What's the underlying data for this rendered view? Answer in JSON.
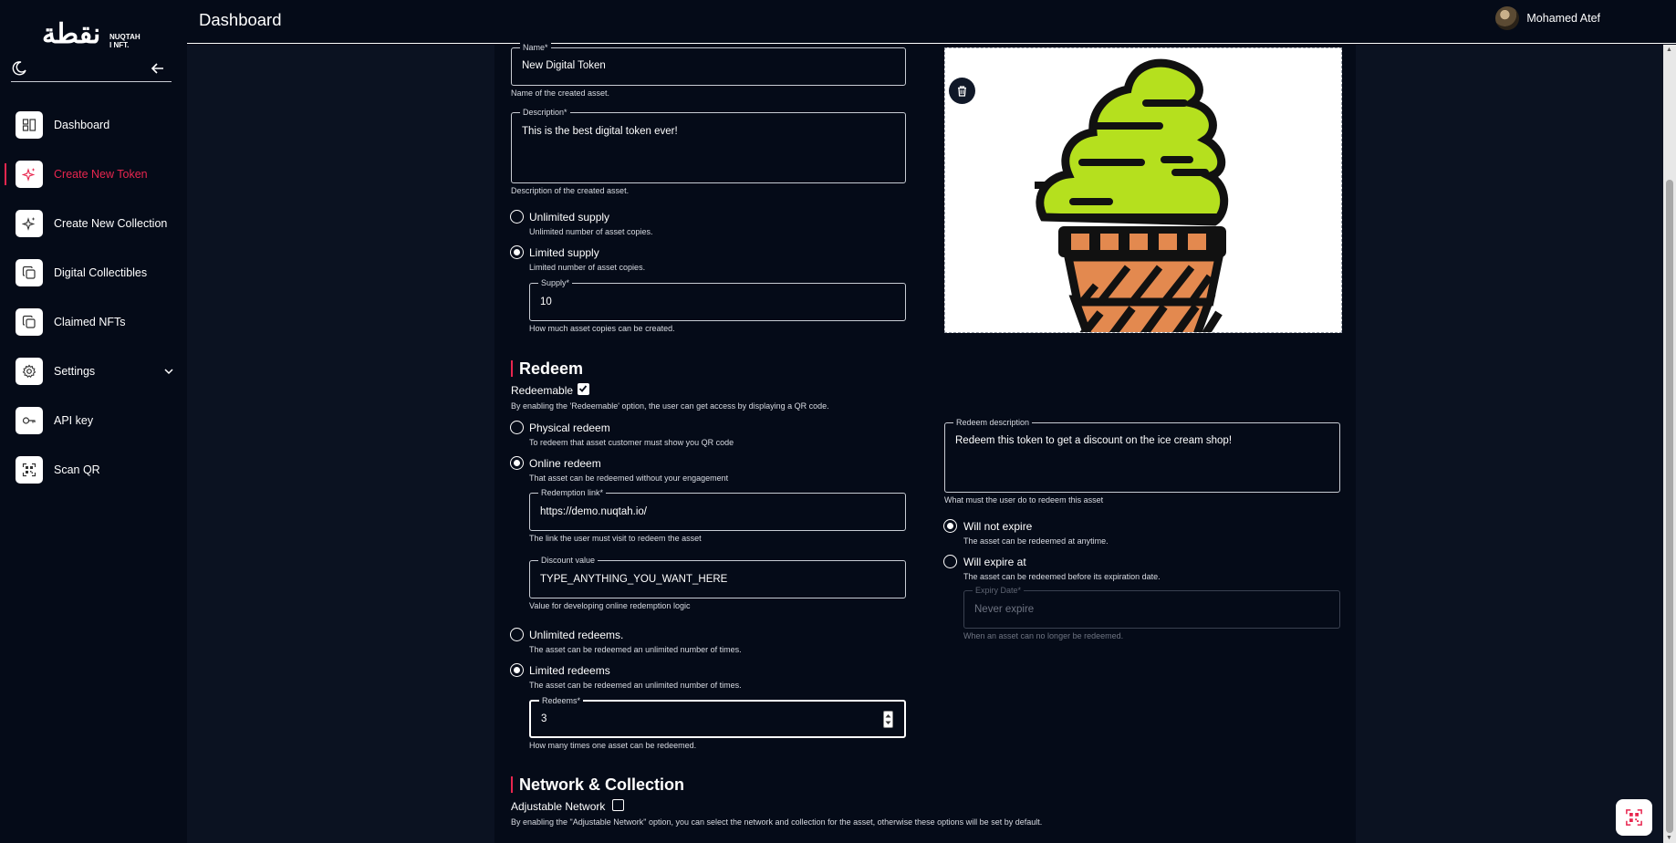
{
  "app": {
    "logo_text": "نقطة",
    "logo_sub_line1": "NUQTAH",
    "logo_sub_line2": "I NFT."
  },
  "topbar": {
    "title": "Dashboard",
    "user_name": "Mohamed Atef"
  },
  "sidebar": {
    "items": [
      {
        "label": "Dashboard",
        "icon": "dashboard-icon",
        "active": false
      },
      {
        "label": "Create New Token",
        "icon": "sparkle-icon",
        "active": true
      },
      {
        "label": "Create New Collection",
        "icon": "sparkle-icon",
        "active": false
      },
      {
        "label": "Digital Collectibles",
        "icon": "copy-icon",
        "active": false
      },
      {
        "label": "Claimed NFTs",
        "icon": "copy-icon",
        "active": false
      },
      {
        "label": "Settings",
        "icon": "gear-icon",
        "active": false
      },
      {
        "label": "API key",
        "icon": "key-icon",
        "active": false
      },
      {
        "label": "Scan QR",
        "icon": "qr-scan-icon",
        "active": false
      }
    ]
  },
  "form": {
    "name": {
      "label": "Name*",
      "value": "New Digital Token",
      "help": "Name of the created asset."
    },
    "description": {
      "label": "Description*",
      "value": "This is the best digital token ever!",
      "help": "Description of the created asset."
    },
    "unlimited_supply": {
      "label": "Unlimited supply",
      "help": "Unlimited number of asset copies.",
      "selected": false
    },
    "limited_supply": {
      "label": "Limited supply",
      "help": "Limited number of asset copies.",
      "selected": true
    },
    "supply": {
      "label": "Supply*",
      "value": "10",
      "help": "How much asset copies can be created."
    }
  },
  "redeem": {
    "title": "Redeem",
    "redeemable_label": "Redeemable",
    "redeemable_checked": true,
    "redeemable_help": "By enabling the 'Redeemable' option, the user can get access by displaying a QR code.",
    "physical": {
      "label": "Physical redeem",
      "help": "To redeem that asset customer must show you QR code",
      "selected": false
    },
    "online": {
      "label": "Online redeem",
      "help": "That asset can be redeemed without your engagement",
      "selected": true
    },
    "redemption_link": {
      "label": "Redemption link*",
      "value": "https://demo.nuqtah.io/",
      "help": "The link the user must visit to redeem the asset"
    },
    "discount": {
      "label": "Discount value",
      "value": "TYPE_ANYTHING_YOU_WANT_HERE",
      "help": "Value for developing online redemption logic"
    },
    "unlimited_redeems": {
      "label": "Unlimited redeems.",
      "help": "The asset can be redeemed an unlimited number of times.",
      "selected": false
    },
    "limited_redeems": {
      "label": "Limited redeems",
      "help": "The asset can be redeemed an unlimited number of times.",
      "selected": true
    },
    "redeems": {
      "label": "Redeems*",
      "value": "3",
      "help": "How many times one asset can be redeemed."
    },
    "redeem_description": {
      "label": "Redeem description",
      "value": "Redeem this token to get a discount on the ice cream shop!",
      "help": "What must the user do to redeem this asset"
    },
    "will_not_expire": {
      "label": "Will not expire",
      "help": "The asset can be redeemed at anytime.",
      "selected": true
    },
    "will_expire": {
      "label": "Will expire at",
      "help": "The asset can be redeemed before its expiration date.",
      "selected": false
    },
    "expiry_date": {
      "label": "Expiry Date*",
      "placeholder": "Never expire",
      "help": "When an asset can no longer be redeemed."
    }
  },
  "network": {
    "title": "Network & Collection",
    "adjustable_label": "Adjustable Network",
    "adjustable_checked": false,
    "adjustable_help": "By enabling the \"Adjustable Network\" option, you can select the network and collection for the asset, otherwise these options will be set by default."
  },
  "colors": {
    "background": "#050b18",
    "accent": "#e8264f",
    "ice_cream_green": "#b5e01e",
    "cone_orange": "#e3894f"
  }
}
